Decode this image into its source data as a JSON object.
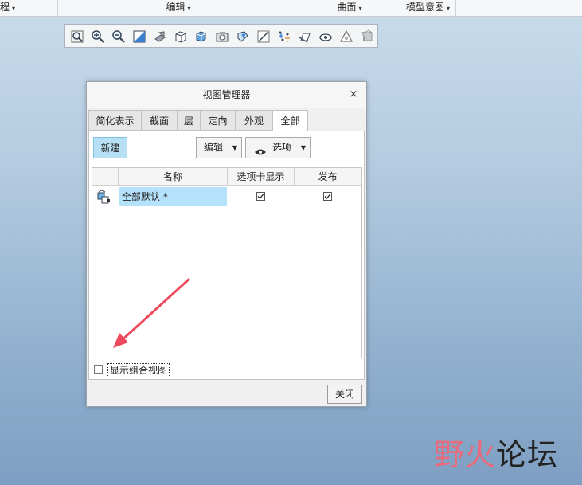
{
  "ribbon": {
    "groups": [
      {
        "label": "程",
        "caret": "▾"
      },
      {
        "label": "编辑",
        "caret": "▾"
      },
      {
        "label": "曲面",
        "caret": "▾"
      },
      {
        "label": "模型意图",
        "caret": "▾"
      }
    ]
  },
  "view_toolbar": {
    "icons": [
      "refit-icon",
      "zoom-in-icon",
      "zoom-out-icon",
      "repaint-icon",
      "perspective-icon",
      "saved-orientations-icon",
      "display-style-icon",
      "view-manager-icon",
      "planes-display-icon",
      "axes-display-icon",
      "points-display-icon",
      "csys-display-icon",
      "annotation-display-icon",
      "pause-icon",
      "spin-center-icon"
    ]
  },
  "dialog": {
    "title": "视图管理器",
    "close_glyph": "×",
    "tabs": [
      "简化表示",
      "截面",
      "层",
      "定向",
      "外观",
      "全部"
    ],
    "active_tab": "全部",
    "buttons": {
      "new": "新建",
      "edit": "编辑",
      "options": "选项",
      "close": "关闭"
    },
    "grid": {
      "columns": [
        "名称",
        "选项卡显示",
        "发布"
      ],
      "rows": [
        {
          "name": "全部默认 *",
          "tab_display": true,
          "publish": true
        }
      ]
    },
    "show_combined_views": {
      "label": "显示组合视图",
      "checked": false
    }
  },
  "watermark": {
    "part1": "野火",
    "part2": "论坛"
  },
  "colors": {
    "selection": "#b5e2fb",
    "new_button": "#b8e0f4",
    "arrow": "#ee4a5e"
  }
}
